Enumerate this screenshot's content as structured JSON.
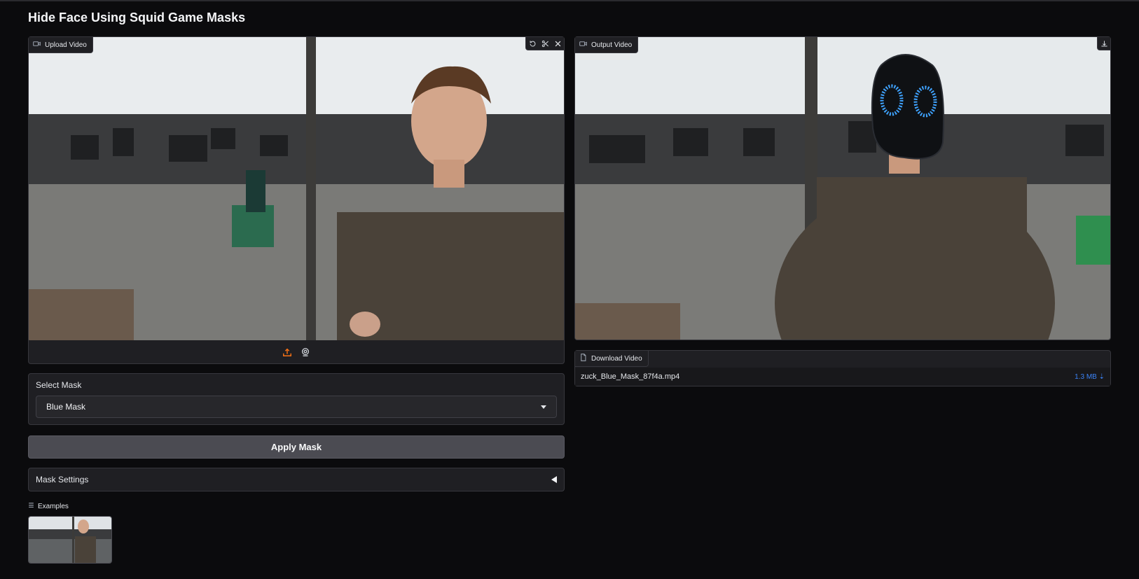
{
  "app": {
    "title": "Hide Face Using Squid Game Masks"
  },
  "upload_video": {
    "label": "Upload Video",
    "icon": "video-icon",
    "controls": [
      "undo-icon",
      "scissors-icon",
      "close-icon"
    ],
    "sources": [
      "upload-icon",
      "webcam-icon"
    ],
    "accent": "#f97316"
  },
  "output_video": {
    "label": "Output Video",
    "icon": "video-icon",
    "controls": [
      "download-icon"
    ]
  },
  "mask_select": {
    "label": "Select Mask",
    "value": "Blue Mask"
  },
  "apply_button": {
    "label": "Apply Mask"
  },
  "mask_settings": {
    "label": "Mask Settings"
  },
  "examples": {
    "label": "Examples"
  },
  "download_file": {
    "label": "Download Video",
    "file_name": "zuck_Blue_Mask_87f4a.mp4",
    "file_size": "1.3 MB ⇣",
    "link_color": "#3b82f6"
  }
}
